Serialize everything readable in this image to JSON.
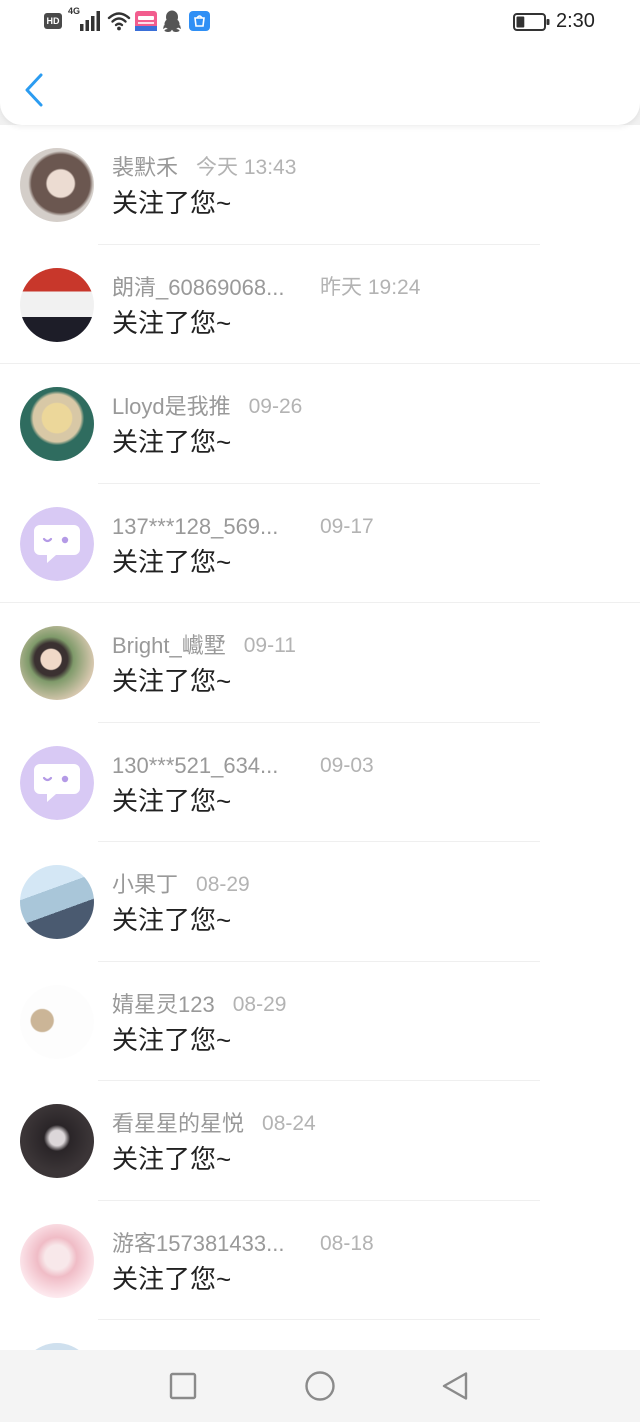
{
  "status_bar": {
    "hd_label": "HD",
    "network_label": "4G",
    "time": "2:30",
    "battery_level_percent": 30,
    "icons": [
      "hd-badge-icon",
      "signal-icon",
      "wifi-icon",
      "bilibili-app-icon",
      "qq-app-icon",
      "app-store-icon",
      "battery-icon"
    ]
  },
  "header": {
    "back_icon": "chevron-left-icon"
  },
  "theme": {
    "accent": "#2b9cf1",
    "name_color": "#999999",
    "time_color": "#b3b3b3",
    "message_color": "#222222",
    "default_avatar_color": "#d8c9f4"
  },
  "notifications": [
    {
      "name": "裴默禾",
      "time": "今天 13:43",
      "message": "关注了您~"
    },
    {
      "name": "朗清_60869068...",
      "time": "昨天 19:24",
      "message": "关注了您~"
    },
    {
      "name": "Lloyd是我推",
      "time": "09-26",
      "message": "关注了您~"
    },
    {
      "name": "137***128_569...",
      "time": "09-17",
      "message": "关注了您~",
      "avatar_icon": "chat-bubble-avatar-icon"
    },
    {
      "name": "Bright_巇墅",
      "time": "09-11",
      "message": "关注了您~"
    },
    {
      "name": "130***521_634...",
      "time": "09-03",
      "message": "关注了您~",
      "avatar_icon": "chat-bubble-avatar-icon"
    },
    {
      "name": "小果丁",
      "time": "08-29",
      "message": "关注了您~"
    },
    {
      "name": "婧星灵123",
      "time": "08-29",
      "message": "关注了您~"
    },
    {
      "name": "看星星的星悦",
      "time": "08-24",
      "message": "关注了您~"
    },
    {
      "name": "游客157381433...",
      "time": "08-18",
      "message": "关注了您~"
    }
  ],
  "nav_bar": {
    "icons": [
      "recent-apps-square-icon",
      "home-circle-icon",
      "back-triangle-icon"
    ]
  }
}
